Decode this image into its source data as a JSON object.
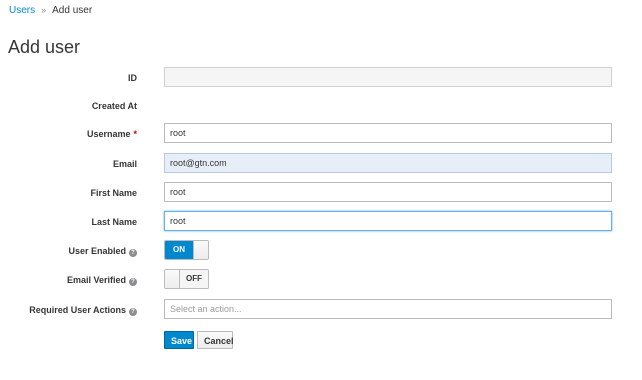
{
  "breadcrumb": {
    "parent": "Users",
    "separator": "»",
    "current": "Add user"
  },
  "page_title": "Add user",
  "form": {
    "id": {
      "label": "ID",
      "value": ""
    },
    "created_at": {
      "label": "Created At",
      "value": ""
    },
    "username": {
      "label": "Username",
      "required_mark": "*",
      "value": "root"
    },
    "email": {
      "label": "Email",
      "value": "root@gtn.com"
    },
    "first_name": {
      "label": "First Name",
      "value": "root"
    },
    "last_name": {
      "label": "Last Name",
      "value": "root"
    },
    "user_enabled": {
      "label": "User Enabled",
      "help": "?",
      "state": "ON"
    },
    "email_verified": {
      "label": "Email Verified",
      "help": "?",
      "state": "OFF"
    },
    "required_actions": {
      "label": "Required User Actions",
      "help": "?",
      "placeholder": "Select an action..."
    }
  },
  "buttons": {
    "save": "Save",
    "cancel": "Cancel"
  },
  "colors": {
    "accent": "#0088ce",
    "required": "#cc0000",
    "autofill": "#e8eef8"
  }
}
